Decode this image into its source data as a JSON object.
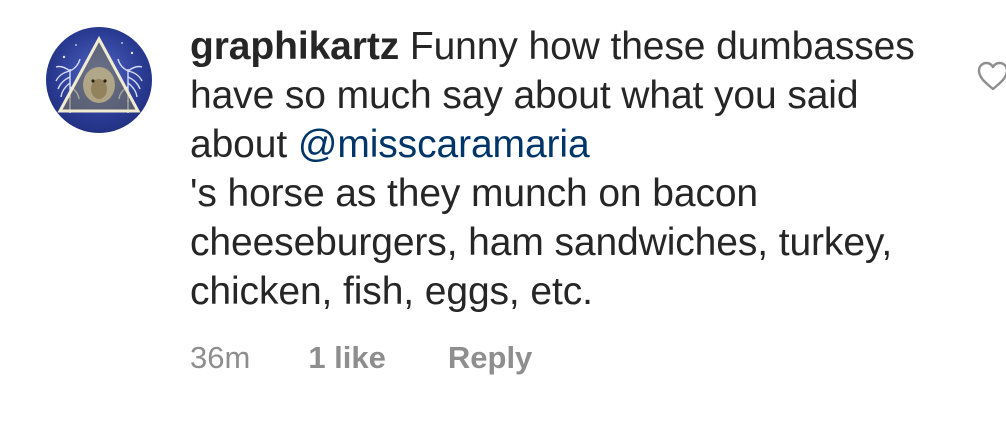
{
  "comment": {
    "username": "graphikartz",
    "text_before_mention": " Funny how these dumbasses have so much say about what you said about ",
    "mention": "@misscaramaria",
    "text_after_mention": "'s horse as they munch on bacon cheeseburgers, ham sandwiches, turkey, chicken, fish, eggs, etc.",
    "timestamp": "36m",
    "likes_label": "1 like",
    "reply_label": "Reply",
    "avatar_icon": "lion-triangle-avatar",
    "like_icon": "heart-outline-icon"
  },
  "colors": {
    "text": "#262626",
    "mention": "#003569",
    "meta": "#8e8e8e",
    "avatar_bg": "#2a3b93"
  }
}
